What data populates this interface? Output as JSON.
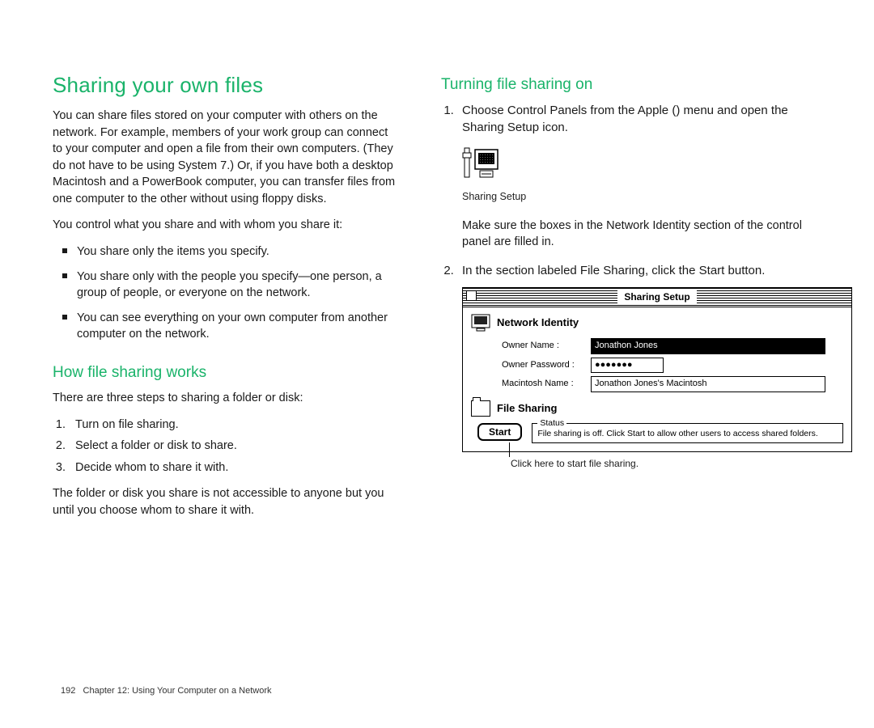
{
  "left": {
    "h1": "Sharing your own files",
    "p1": "You can share files stored on your computer with others on the network. For example, members of your work group can connect to your computer and open a file from their own computers. (They do not have to be using System 7.) Or, if you have both a desktop Macintosh and a PowerBook computer, you can transfer files from one computer to the other without using floppy disks.",
    "p2": "You control what you share and with whom you share it:",
    "bullets": {
      "0": "You share only the items you specify.",
      "1": "You share only with the people you specify—one person, a group of people, or everyone on the network.",
      "2": "You can see everything on your own computer from another computer on the network."
    },
    "h2": "How file sharing works",
    "p3": "There are three steps to sharing a folder or disk:",
    "steps": {
      "0": "Turn on file sharing.",
      "1": "Select a folder or disk to share.",
      "2": "Decide whom to share it with."
    },
    "p4": "The folder or disk you share is not accessible to anyone but you until you choose whom to share it with."
  },
  "right": {
    "h2": "Turning file sharing on",
    "step1_pre": "Choose Control Panels from the Apple (",
    "step1_post": ") menu and open the Sharing Setup icon.",
    "icon_label": "Sharing Setup",
    "note": "Make sure the boxes in the Network Identity section of the control panel are filled in.",
    "step2": "In the section labeled File Sharing, click the Start button.",
    "panel": {
      "title": "Sharing Setup",
      "section1": "Network Identity",
      "owner_name_label": "Owner Name :",
      "owner_name_value": "Jonathon Jones",
      "owner_pw_label": "Owner Password :",
      "owner_pw_value": "●●●●●●●",
      "mac_name_label": "Macintosh Name :",
      "mac_name_value": "Jonathon Jones's Macintosh",
      "section2": "File Sharing",
      "start": "Start",
      "status_label": "Status",
      "status_text": "File sharing is off. Click Start to allow other users to access shared folders."
    },
    "callout": "Click here to start file sharing."
  },
  "footer": {
    "page": "192",
    "chapter": "Chapter 12: Using Your Computer on a Network"
  }
}
